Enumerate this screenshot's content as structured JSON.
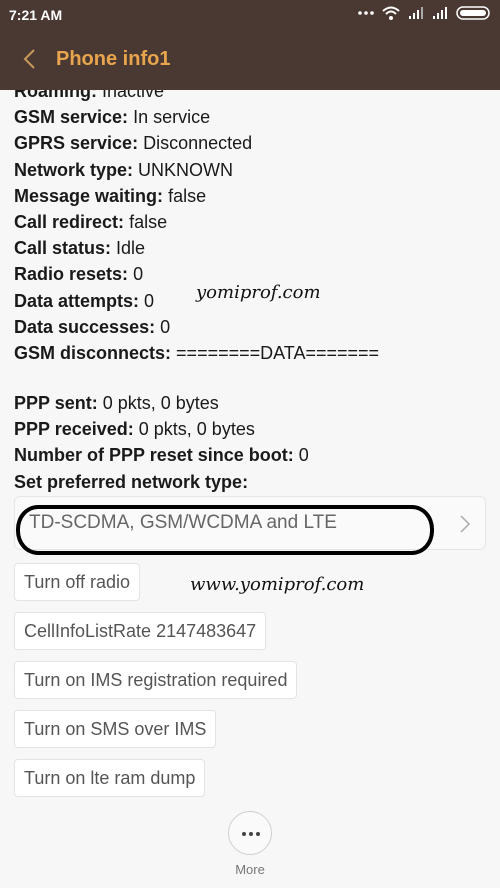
{
  "status_bar": {
    "time": "7:21 AM",
    "icons": [
      "more-dots-icon",
      "wifi-icon",
      "signal-icon",
      "signal-icon",
      "battery-icon"
    ]
  },
  "header": {
    "title": "Phone info1",
    "back_icon": "chevron-left-icon",
    "bg": "#4a3933",
    "title_color": "#e8a54e"
  },
  "info": [
    {
      "label": "Roaming:",
      "value": "Inactive"
    },
    {
      "label": "GSM service:",
      "value": "In service"
    },
    {
      "label": "GPRS service:",
      "value": "Disconnected"
    },
    {
      "label": "Network type:",
      "value": "UNKNOWN"
    },
    {
      "label": "Message waiting:",
      "value": "false"
    },
    {
      "label": "Call redirect:",
      "value": "false"
    },
    {
      "label": "Call status:",
      "value": "Idle"
    },
    {
      "label": "Radio resets:",
      "value": "0"
    },
    {
      "label": "Data attempts:",
      "value": "0"
    },
    {
      "label": "Data successes:",
      "value": "0"
    },
    {
      "label": "GSM disconnects:",
      "value": "========DATA======="
    }
  ],
  "ppp": [
    {
      "label": "PPP sent:",
      "value": "0 pkts, 0 bytes"
    },
    {
      "label": "PPP received:",
      "value": "0 pkts, 0 bytes"
    },
    {
      "label": "Number of PPP reset since boot:",
      "value": "0"
    },
    {
      "label": "Set preferred network type:",
      "value": ""
    }
  ],
  "network_type": {
    "selected": "TD-SCDMA, GSM/WCDMA and LTE"
  },
  "buttons": [
    "Turn off radio",
    "CellInfoListRate 2147483647",
    "Turn on IMS registration required",
    "Turn on SMS over IMS",
    "Turn on lte ram dump"
  ],
  "watermarks": [
    "yomiprof.com",
    "www.yomiprof.com"
  ],
  "bottom": {
    "more_label": "More"
  }
}
